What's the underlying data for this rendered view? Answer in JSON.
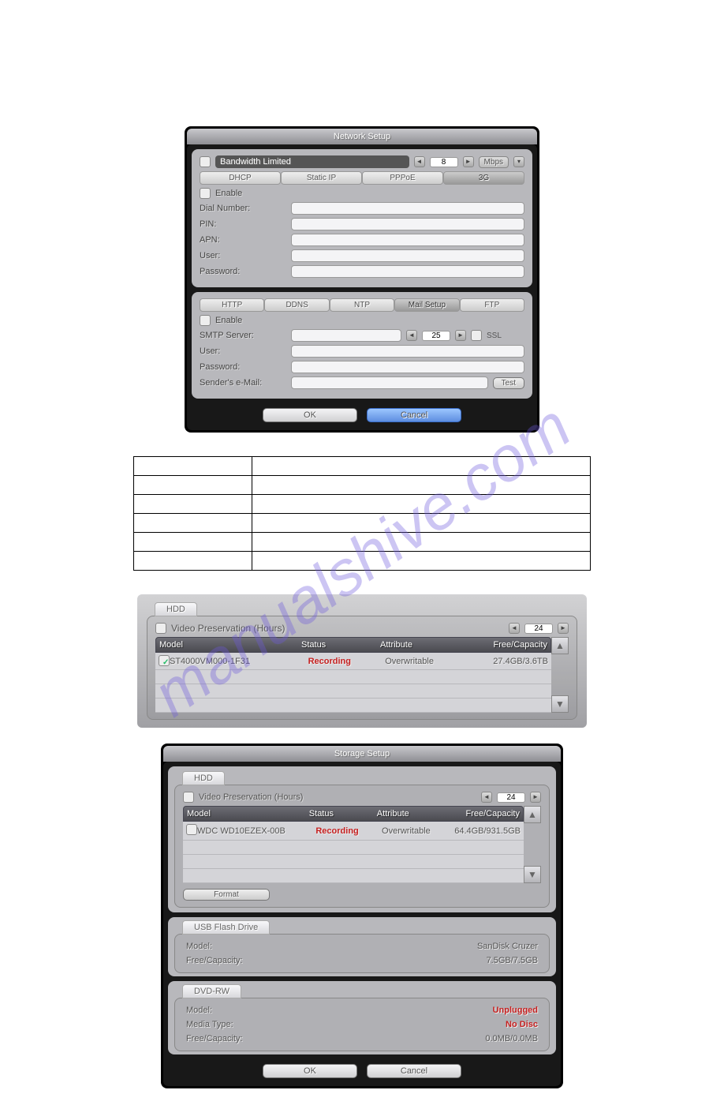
{
  "watermark": "manualshive.com",
  "network_dialog": {
    "title": "Network Setup",
    "bandwidth_label": "Bandwidth Limited",
    "bandwidth_value": "8",
    "bandwidth_unit": "Mbps",
    "conn_tabs": [
      "DHCP",
      "Static IP",
      "PPPoE",
      "3G"
    ],
    "conn_active": "3G",
    "enable_label": "Enable",
    "fields_3g": {
      "dial": "Dial Number:",
      "pin": "PIN:",
      "apn": "APN:",
      "user": "User:",
      "password": "Password:"
    },
    "svc_tabs": [
      "HTTP",
      "DDNS",
      "NTP",
      "Mail Setup",
      "FTP"
    ],
    "svc_active": "Mail Setup",
    "fields_mail": {
      "smtp": "SMTP Server:",
      "port": "25",
      "ssl": "SSL",
      "user": "User:",
      "password": "Password:",
      "sender": "Sender's e-Mail:",
      "test": "Test"
    },
    "ok": "OK",
    "cancel": "Cancel"
  },
  "desc_table_rows": 6,
  "hdd_block": {
    "tab": "HDD",
    "preservation_label": "Video Preservation (Hours)",
    "preservation_value": "24",
    "headers": {
      "model": "Model",
      "status": "Status",
      "attribute": "Attribute",
      "capacity": "Free/Capacity"
    },
    "row": {
      "model": "ST4000VM000-1F31",
      "status": "Recording",
      "attribute": "Overwritable",
      "capacity": "27.4GB/3.6TB",
      "checked": true
    }
  },
  "storage_dialog": {
    "title": "Storage Setup",
    "hdd_tab": "HDD",
    "preservation_label": "Video Preservation (Hours)",
    "preservation_value": "24",
    "headers": {
      "model": "Model",
      "status": "Status",
      "attribute": "Attribute",
      "capacity": "Free/Capacity"
    },
    "row": {
      "model": "WDC WD10EZEX-00B",
      "status": "Recording",
      "attribute": "Overwritable",
      "capacity": "64.4GB/931.5GB"
    },
    "format_btn": "Format",
    "usb_tab": "USB Flash Drive",
    "usb_model_label": "Model:",
    "usb_model_value": "SanDisk Cruzer",
    "usb_capacity_label": "Free/Capacity:",
    "usb_capacity_value": "7.5GB/7.5GB",
    "dvd_tab": "DVD-RW",
    "dvd_model_label": "Model:",
    "dvd_model_value": "Unplugged",
    "dvd_media_label": "Media Type:",
    "dvd_media_value": "No Disc",
    "dvd_capacity_label": "Free/Capacity:",
    "dvd_capacity_value": "0.0MB/0.0MB",
    "ok": "OK",
    "cancel": "Cancel"
  }
}
